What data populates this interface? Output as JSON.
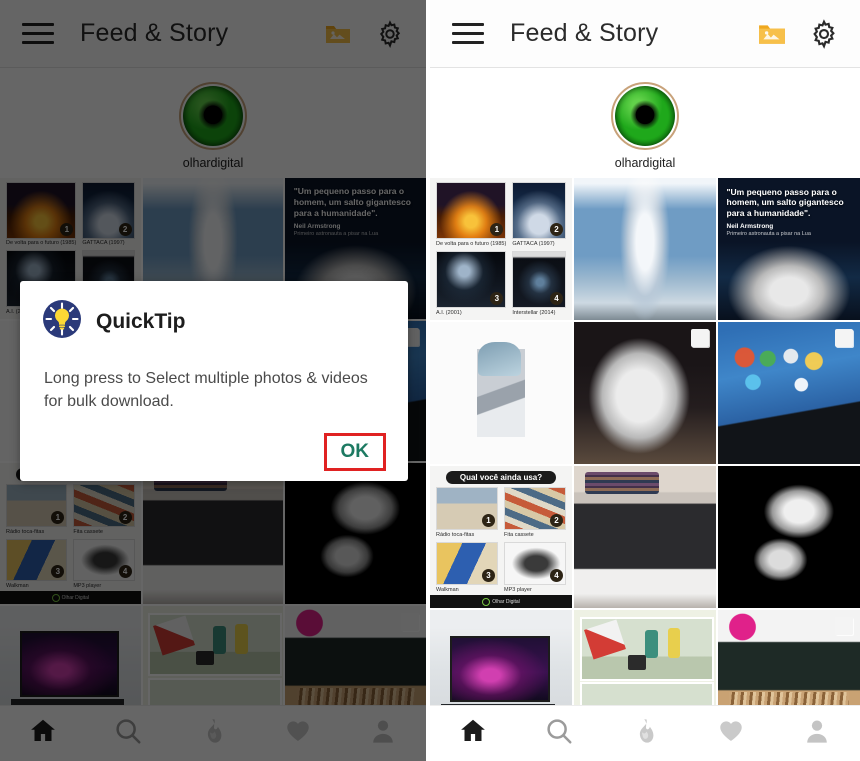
{
  "app": {
    "title": "Feed & Story",
    "menu_icon": "hamburger-menu-icon",
    "folder_icon": "image-folder-icon",
    "settings_icon": "gear-icon"
  },
  "story": {
    "username": "olhardigital",
    "avatar_icon": "green-eye-avatar"
  },
  "dialog": {
    "icon": "lightbulb-icon",
    "title": "QuickTip",
    "message": "Long press to Select multiple photos & videos for bulk download.",
    "ok_label": "OK",
    "highlight_color": "#e02222",
    "ok_color": "#1d7a62"
  },
  "bottom_nav": [
    {
      "name": "home",
      "icon": "home-icon",
      "active": true
    },
    {
      "name": "search",
      "icon": "search-icon",
      "active": false
    },
    {
      "name": "trending",
      "icon": "flame-icon",
      "active": false
    },
    {
      "name": "likes",
      "icon": "heart-icon",
      "active": false
    },
    {
      "name": "profile",
      "icon": "person-icon",
      "active": false
    }
  ],
  "collages": {
    "movies": {
      "title": "",
      "items": [
        {
          "num": "1",
          "caption": "De volta para o futuro (1985)",
          "art": "p-bttf"
        },
        {
          "num": "2",
          "caption": "GATTACA (1997)",
          "art": "p-gattaca"
        },
        {
          "num": "3",
          "caption": "A.I. (2001)",
          "art": "p-ai"
        },
        {
          "num": "4",
          "caption": "Interstellar (2014)",
          "art": "p-inter"
        }
      ]
    },
    "retro": {
      "title": "Qual você ainda usa?",
      "foot_text": "Olhar Digital",
      "items": [
        {
          "num": "1",
          "caption": "Rádio toca-fitas",
          "art": "p-radio"
        },
        {
          "num": "2",
          "caption": "Fita cassete",
          "art": "p-tapes"
        },
        {
          "num": "3",
          "caption": "Walkman",
          "art": "p-walk"
        },
        {
          "num": "4",
          "caption": "MP3 player",
          "art": "p-mp3"
        }
      ]
    }
  },
  "astronaut_post": {
    "quote": "\"Um pequeno passo para o homem, um salto gigantesco para a humanidade\".",
    "author": "Neil Armstrong",
    "subtitle": "Primeiro astronauta a pisar na Lua"
  },
  "posts": [
    {
      "name": "movie-posters-collage",
      "kind": "collage-movies",
      "multi": false
    },
    {
      "name": "rocket-launch-photo",
      "kind": "ph-rocket",
      "multi": false
    },
    {
      "name": "astronaut-quote-photo",
      "kind": "ph-astro",
      "multi": false
    },
    {
      "name": "gadget-photo",
      "kind": "ph-gadget",
      "multi": false
    },
    {
      "name": "robot-dog-photo",
      "kind": "ph-dog",
      "multi": true
    },
    {
      "name": "tablet-photo",
      "kind": "ph-tablet",
      "multi": true
    },
    {
      "name": "retro-tech-collage",
      "kind": "collage-retro",
      "multi": false
    },
    {
      "name": "printer-photo",
      "kind": "ph-printer",
      "multi": false
    },
    {
      "name": "ultima-thule-photo",
      "kind": "ph-thule",
      "multi": false
    },
    {
      "name": "oled-tv-photo",
      "kind": "ph-tv",
      "multi": false
    },
    {
      "name": "comic-illustration-photo",
      "kind": "ph-comic",
      "multi": false
    },
    {
      "name": "lg-display-photo",
      "kind": "ph-lg",
      "multi": true
    }
  ]
}
